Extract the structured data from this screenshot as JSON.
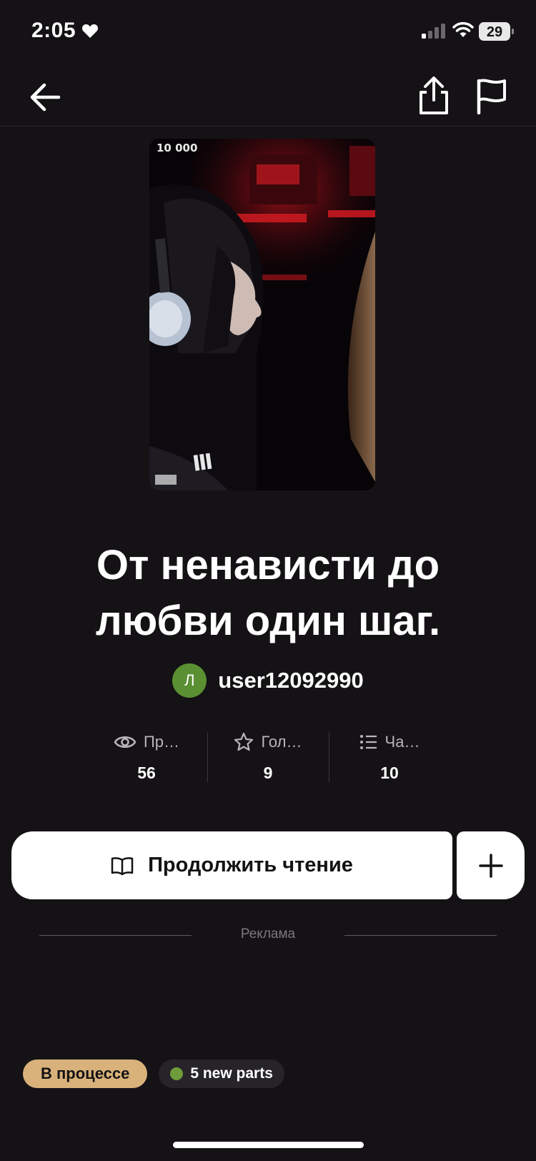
{
  "status_bar": {
    "time": "2:05",
    "battery": "29"
  },
  "cover": {
    "badge": "10 000"
  },
  "book": {
    "title": "От ненависти до любви один шаг."
  },
  "author": {
    "initial": "Л",
    "name": "user12092990",
    "avatar_color": "#5a8f32"
  },
  "stats": [
    {
      "icon": "eye-icon",
      "label": "Пр…",
      "value": "56"
    },
    {
      "icon": "star-icon",
      "label": "Гол…",
      "value": "9"
    },
    {
      "icon": "list-icon",
      "label": "Ча…",
      "value": "10"
    }
  ],
  "actions": {
    "read_label": "Продолжить чтение"
  },
  "ad": {
    "label": "Реклама"
  },
  "tags": {
    "status": "В процессе",
    "new_parts": "5 new parts"
  },
  "colors": {
    "background": "#141215",
    "status_tag": "#d8b27a",
    "new_dot": "#6f9c3a"
  }
}
